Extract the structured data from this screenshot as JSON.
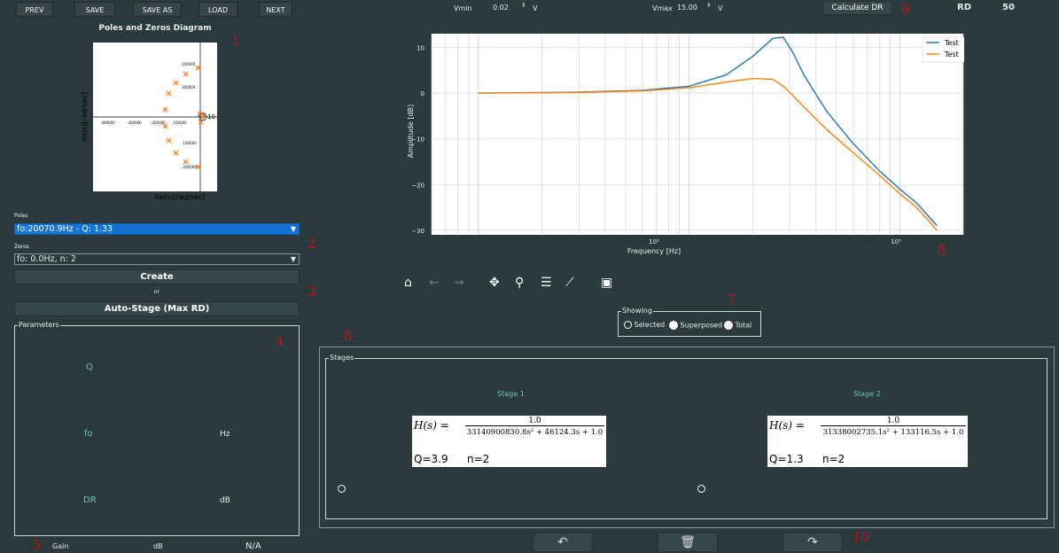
{
  "toolbar": {
    "prev": "PREV",
    "save": "SAVE",
    "save_as": "SAVE AS",
    "load": "LOAD",
    "next": "NEXT"
  },
  "pz": {
    "title": "Poles and Zeros Diagram",
    "xlabel": "Re(s)[rad/sec]",
    "ylabel": "Im(s)[rad/sec]",
    "xticks": [
      "-400000",
      "-300000",
      "-200000",
      "-100000"
    ],
    "yticks": [
      "200000",
      "100000",
      "-100000",
      "-200000"
    ],
    "zero_label": "10"
  },
  "poles": {
    "label": "Poles",
    "selected": "fo:20070.9Hz - Q: 1.33"
  },
  "zeros": {
    "label": "Zeros",
    "selected": "fo: 0.0Hz, n: 2"
  },
  "create_label": "Create",
  "or_label": "or",
  "autostage_label": "Auto-Stage (Max RD)",
  "parameters": {
    "title": "Parameters",
    "q": "Q",
    "fo": "fo",
    "hz": "Hz",
    "dr": "DR",
    "db": "dB"
  },
  "gain": {
    "label": "Gain",
    "unit": "dB",
    "value": "N/A"
  },
  "vmin": {
    "label": "Vmin",
    "value": "0.02",
    "unit": "V"
  },
  "vmax": {
    "label": "Vmax",
    "value": "15.00",
    "unit": "V"
  },
  "calc_dr_label": "Calculate DR",
  "rd": {
    "label": "RD",
    "value": "50"
  },
  "plot": {
    "ylabel": "Amplitude [dB]",
    "xlabel": "Frequency [Hz]",
    "xticks": [
      "10³",
      "10³"
    ],
    "yticks": [
      "10",
      "0",
      "−10",
      "−20",
      "−30"
    ],
    "legend": [
      "Test",
      "Test"
    ],
    "colors": {
      "s1": "#1f77b4",
      "s2": "#ff7f0e"
    }
  },
  "chart_data": {
    "type": "line",
    "xlabel": "Frequency [Hz]",
    "ylabel": "Amplitude [dB]",
    "ylim": [
      -31,
      13
    ],
    "series": [
      {
        "name": "Test",
        "x": [
          100,
          300,
          600,
          1000,
          1500,
          2000,
          2500,
          2800,
          3100,
          3500,
          4500,
          6000,
          8000,
          10000,
          12000,
          15000
        ],
        "y": [
          0,
          0.2,
          0.6,
          1.5,
          4,
          8,
          12,
          12.2,
          9,
          4,
          -4,
          -11,
          -17,
          -21,
          -24,
          -29
        ]
      },
      {
        "name": "Test",
        "x": [
          100,
          300,
          600,
          1000,
          1500,
          2000,
          2500,
          2800,
          3100,
          3500,
          4500,
          6000,
          8000,
          10000,
          12000,
          15000
        ],
        "y": [
          0,
          0.15,
          0.5,
          1.2,
          2.4,
          3.2,
          3,
          1.5,
          -0.5,
          -3,
          -8,
          -13,
          -18,
          -22,
          -25,
          -30
        ]
      }
    ]
  },
  "showing": {
    "title": "Showing",
    "selected": "Selected",
    "superposed": "Superposed",
    "total": "Total"
  },
  "stages": {
    "title": "Stages",
    "list": [
      {
        "title": "Stage 1",
        "lhs": "H(s) =",
        "num": "1.0",
        "den": "33140900830.8s² + 46124.3s + 1.0",
        "q": "Q=3.9",
        "n": "n=2"
      },
      {
        "title": "Stage 2",
        "lhs": "H(s) =",
        "num": "1.0",
        "den": "31338002735.1s² + 133116.5s + 1.0",
        "q": "Q=1.3",
        "n": "n=2"
      }
    ]
  },
  "markers": [
    "1",
    "2",
    "3",
    "4",
    "5",
    "6",
    "7",
    "8",
    "9",
    "10"
  ],
  "icons": [
    "home-icon",
    "back-arrow-icon",
    "forward-arrow-icon",
    "pan-icon",
    "zoom-icon",
    "configure-icon",
    "edit-axis-icon",
    "save-figure-icon",
    "undo-icon",
    "trash-icon",
    "redo-icon"
  ]
}
